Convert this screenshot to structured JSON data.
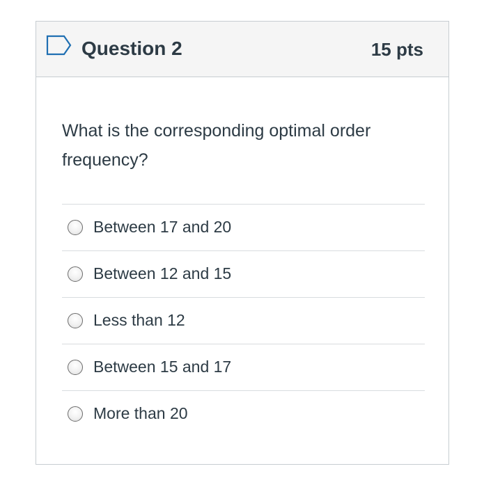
{
  "question": {
    "title": "Question 2",
    "points": "15 pts",
    "flag_icon": "flag-outline-icon",
    "text": "What is the corresponding optimal order frequency?",
    "answers": [
      {
        "label": "Between 17 and 20",
        "selected": false
      },
      {
        "label": "Between 12 and 15",
        "selected": false
      },
      {
        "label": "Less than 12",
        "selected": false
      },
      {
        "label": "Between 15 and 17",
        "selected": false
      },
      {
        "label": "More than 20",
        "selected": false
      }
    ]
  },
  "colors": {
    "text": "#2d3b45",
    "border": "#c7cdd1",
    "header_bg": "#f5f5f5",
    "flag": "#1f6fb2"
  }
}
